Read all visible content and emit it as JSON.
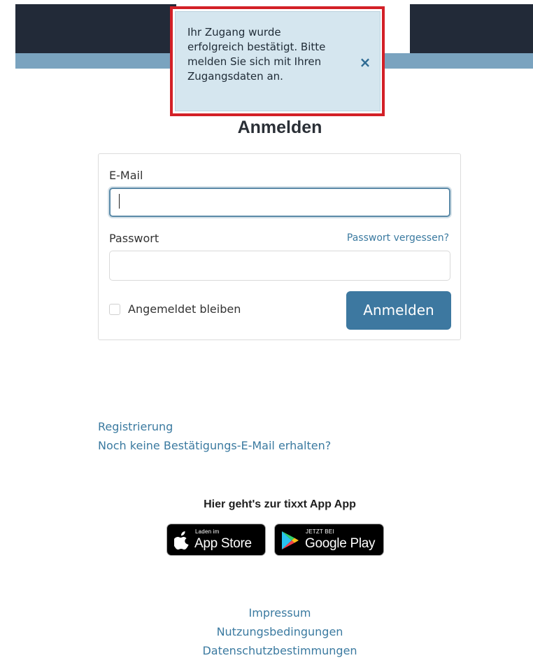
{
  "alert": {
    "message_lines": [
      "Ihr Zugang wurde",
      "erfolgreich bestätigt. Bitte",
      "melden Sie sich mit Ihren",
      "Zugangsdaten an."
    ],
    "close_icon": "close-icon",
    "highlight_color": "#d32027",
    "background_color": "#d5e6ef"
  },
  "login": {
    "title": "Anmelden",
    "email_label": "E-Mail",
    "email_value": "",
    "password_label": "Passwort",
    "password_value": "",
    "forgot_password_link": "Passwort vergessen?",
    "remember_me_label": "Angemeldet bleiben",
    "remember_me_checked": false,
    "submit_label": "Anmelden",
    "accent_color": "#3d78a0"
  },
  "links": {
    "register": "Registrierung",
    "no_confirmation_email": "Noch keine Bestätigungs-E-Mail erhalten?"
  },
  "app_section": {
    "heading": "Hier geht's zur tixxt App App",
    "app_store": {
      "small_text": "Laden im",
      "big_text": "App Store",
      "icon": "apple-icon"
    },
    "google_play": {
      "small_text": "JETZT BEI",
      "big_text": "Google Play",
      "icon": "google-play-icon"
    }
  },
  "footer": {
    "imprint": "Impressum",
    "terms": "Nutzungsbedingungen",
    "privacy": "Datenschutzbestimmungen"
  },
  "colors": {
    "header_dark": "#222a38",
    "header_band": "#7aa3bf",
    "link": "#3b7aa0"
  }
}
